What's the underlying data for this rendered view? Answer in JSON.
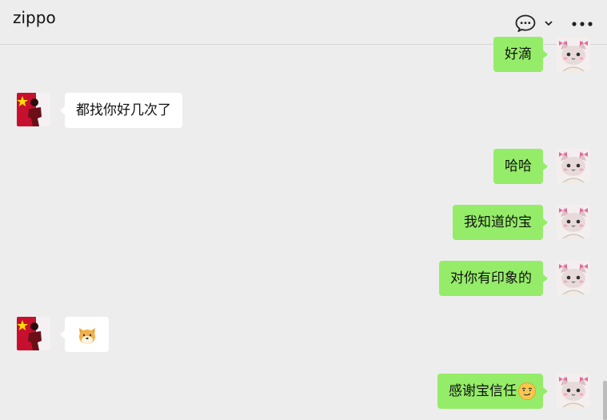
{
  "header": {
    "title": "zippo",
    "chat_icon": "speech-bubble-icon",
    "dropdown_icon": "chevron-down-icon",
    "more_icon": "more-dots-icon"
  },
  "messages": [
    {
      "from": "me",
      "text": "好滴"
    },
    {
      "from": "them",
      "text": "都找你好几次了"
    },
    {
      "from": "me",
      "text": "哈哈"
    },
    {
      "from": "me",
      "text": "我知道的宝"
    },
    {
      "from": "me",
      "text": "对你有印象的"
    },
    {
      "from": "them",
      "text": "",
      "emoji": "dog-face-emoji"
    },
    {
      "from": "me",
      "text": "感谢宝信任",
      "emoji": "smirk-emoji"
    }
  ],
  "colors": {
    "background": "#ededed",
    "my_bubble": "#95ec69",
    "their_bubble": "#ffffff"
  }
}
